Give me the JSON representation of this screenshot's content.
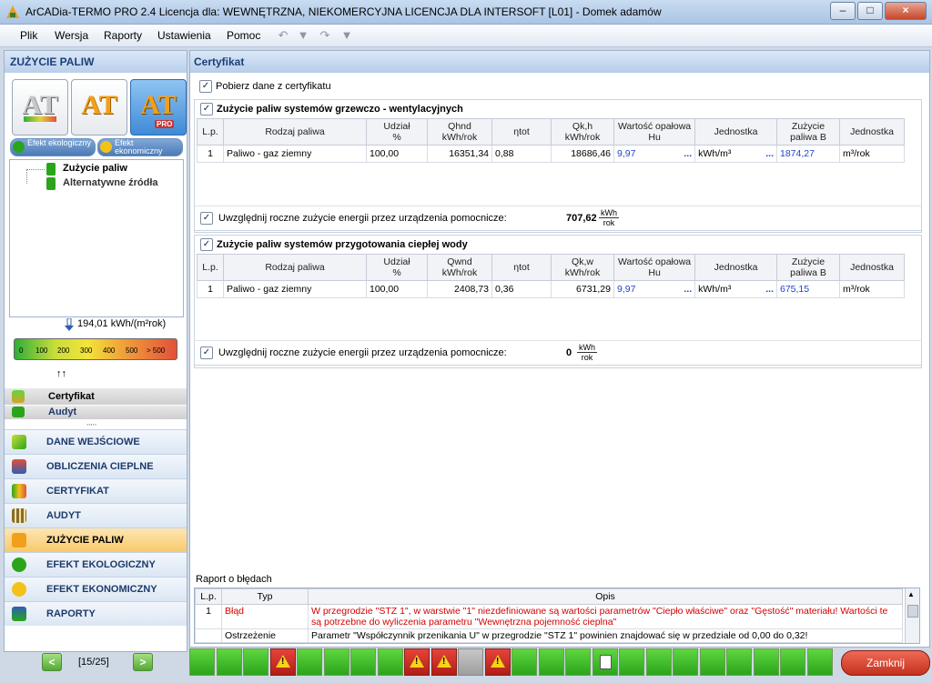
{
  "window": {
    "title": "ArCADia-TERMO PRO 2.4 Licencja dla: WEWNĘTRZNA, NIEKOMERCYJNA LICENCJA DLA INTERSOFT [L01] - Domek adamów",
    "minimize": "–",
    "maximize": "□",
    "close": "×"
  },
  "menu": {
    "items": [
      "Plik",
      "Wersja",
      "Raporty",
      "Ustawienia",
      "Pomoc"
    ]
  },
  "left": {
    "header": "ZUŻYCIE PALIW",
    "big_buttons": [
      {
        "label": "AT"
      },
      {
        "label": "AT"
      },
      {
        "label": "AT",
        "badge": "PRO"
      }
    ],
    "tabs": [
      {
        "label": "Efekt ekologiczny"
      },
      {
        "label": "Efekt ekonomiczny"
      }
    ],
    "tree": [
      "Zużycie paliw",
      "Alternatywne źródła"
    ],
    "gauge": {
      "value_label": "194,01 kWh/(m²rok)",
      "ticks": [
        "0",
        "100",
        "200",
        "300",
        "400",
        "500",
        "> 500"
      ],
      "marker": "↑↑"
    },
    "small_sections": [
      "Certyfikat",
      "Audyt"
    ],
    "sections": [
      {
        "label": "DANE WEJŚCIOWE",
        "active": false
      },
      {
        "label": "OBLICZENIA CIEPLNE",
        "active": false
      },
      {
        "label": "CERTYFIKAT",
        "active": false
      },
      {
        "label": "AUDYT",
        "active": false
      },
      {
        "label": "ZUŻYCIE PALIW",
        "active": true
      },
      {
        "label": "EFEKT EKOLOGICZNY",
        "active": false
      },
      {
        "label": "EFEKT EKONOMICZNY",
        "active": false
      },
      {
        "label": "RAPORTY",
        "active": false
      }
    ],
    "nav": {
      "prev": "<",
      "page": "[15/25]",
      "next": ">"
    }
  },
  "right": {
    "header": "Certyfikat",
    "fetch_checkbox": "Pobierz dane z certyfikatu",
    "groups": [
      {
        "title": "Zużycie paliw systemów grzewczo - wentylacyjnych",
        "columns": [
          "L.p.",
          "Rodzaj paliwa",
          "Udział\n%",
          "Qhnd\nkWh/rok",
          "ηtot",
          "Qk,h\nkWh/rok",
          "Wartość opałowa\nHu",
          "",
          "Jednostka",
          "",
          "Zużycie\npaliwa B",
          "Jednostka"
        ],
        "rows": [
          [
            "1",
            "Paliwo - gaz ziemny",
            "100,00",
            "16351,34",
            "0,88",
            "18686,46",
            "9,97",
            "...",
            "kWh/m³",
            "...",
            "1874,27",
            "m³/rok"
          ]
        ],
        "aux_label": "Uwzględnij roczne zużycie energii przez urządzenia pomocnicze:",
        "aux_value": "707,62",
        "aux_unit_num": "kWh",
        "aux_unit_den": "rok"
      },
      {
        "title": "Zużycie paliw systemów przygotowania ciepłej wody",
        "columns": [
          "L.p.",
          "Rodzaj paliwa",
          "Udział\n%",
          "Qwnd\nkWh/rok",
          "ηtot",
          "Qk,w\nkWh/rok",
          "Wartość opałowa\nHu",
          "",
          "Jednostka",
          "",
          "Zużycie\npaliwa B",
          "Jednostka"
        ],
        "rows": [
          [
            "1",
            "Paliwo - gaz ziemny",
            "100,00",
            "2408,73",
            "0,36",
            "6731,29",
            "9,97",
            "...",
            "kWh/m³",
            "...",
            "675,15",
            "m³/rok"
          ]
        ],
        "aux_label": "Uwzględnij roczne zużycie energii przez urządzenia pomocnicze:",
        "aux_value": "0",
        "aux_unit_num": "kWh",
        "aux_unit_den": "rok"
      }
    ],
    "report": {
      "title": "Raport o błędach",
      "columns": [
        "L.p.",
        "Typ",
        "Opis"
      ],
      "rows": [
        [
          "1",
          "Błąd",
          "W przegrodzie \"STZ 1\", w warstwie \"1\" niezdefiniowane są wartości parametrów \"Ciepło właściwe\" oraz \"Gęstość\" materiału! Wartości te są potrzebne do wyliczenia parametru \"Wewnętrzna pojemność cieplna\""
        ],
        [
          "",
          "Ostrzeżenie",
          "Parametr \"Współczynnik przenikania U\" w przegrodzie \"STZ 1\" powinien znajdować się w przedziale od 0,00 do 0,32!"
        ]
      ]
    },
    "status_squares": [
      "ok",
      "ok",
      "ok",
      "err",
      "ok",
      "ok",
      "ok",
      "ok",
      "err",
      "err",
      "grey",
      "err",
      "ok",
      "ok",
      "ok",
      "doc",
      "ok",
      "ok",
      "ok",
      "ok",
      "ok",
      "ok",
      "ok",
      "ok",
      "ok",
      "ok",
      "ok",
      "ok",
      "ok",
      "ok",
      "ok"
    ],
    "close_button": "Zamknij"
  },
  "colors": {
    "accent": "#3f8ad6",
    "active_section": "#f8c96a",
    "error": "#d40000",
    "link_blue": "#2244cc"
  }
}
